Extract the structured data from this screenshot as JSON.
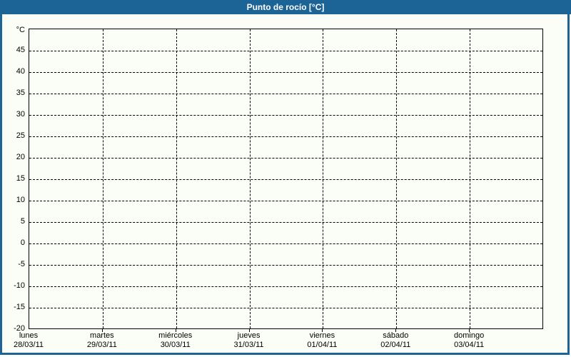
{
  "window": {
    "title": "Punto de rocío [°C]"
  },
  "colors": {
    "frame_blue": "#1d6496",
    "background": "#fbfdf7",
    "grid": "#000000",
    "title_text": "#ffffff",
    "label_text": "#000000"
  },
  "chart_data": {
    "type": "line",
    "title": "Punto de rocío [°C]",
    "xlabel": "",
    "ylabel": "°C",
    "ylim": [
      -20,
      50
    ],
    "y_tick_step": 5,
    "y_tick_labels": [
      "45",
      "40",
      "35",
      "30",
      "25",
      "20",
      "15",
      "10",
      "5",
      "0",
      "-5",
      "-10",
      "-15",
      "-20"
    ],
    "x_categories": [
      {
        "day": "lunes",
        "date": "28/03/11"
      },
      {
        "day": "martes",
        "date": "29/03/11"
      },
      {
        "day": "miércoles",
        "date": "30/03/11"
      },
      {
        "day": "jueves",
        "date": "31/03/11"
      },
      {
        "day": "viernes",
        "date": "01/04/11"
      },
      {
        "day": "sábado",
        "date": "02/04/11"
      },
      {
        "day": "domingo",
        "date": "03/04/11"
      }
    ],
    "series": [],
    "grid": "dashed",
    "legend_position": "none"
  }
}
